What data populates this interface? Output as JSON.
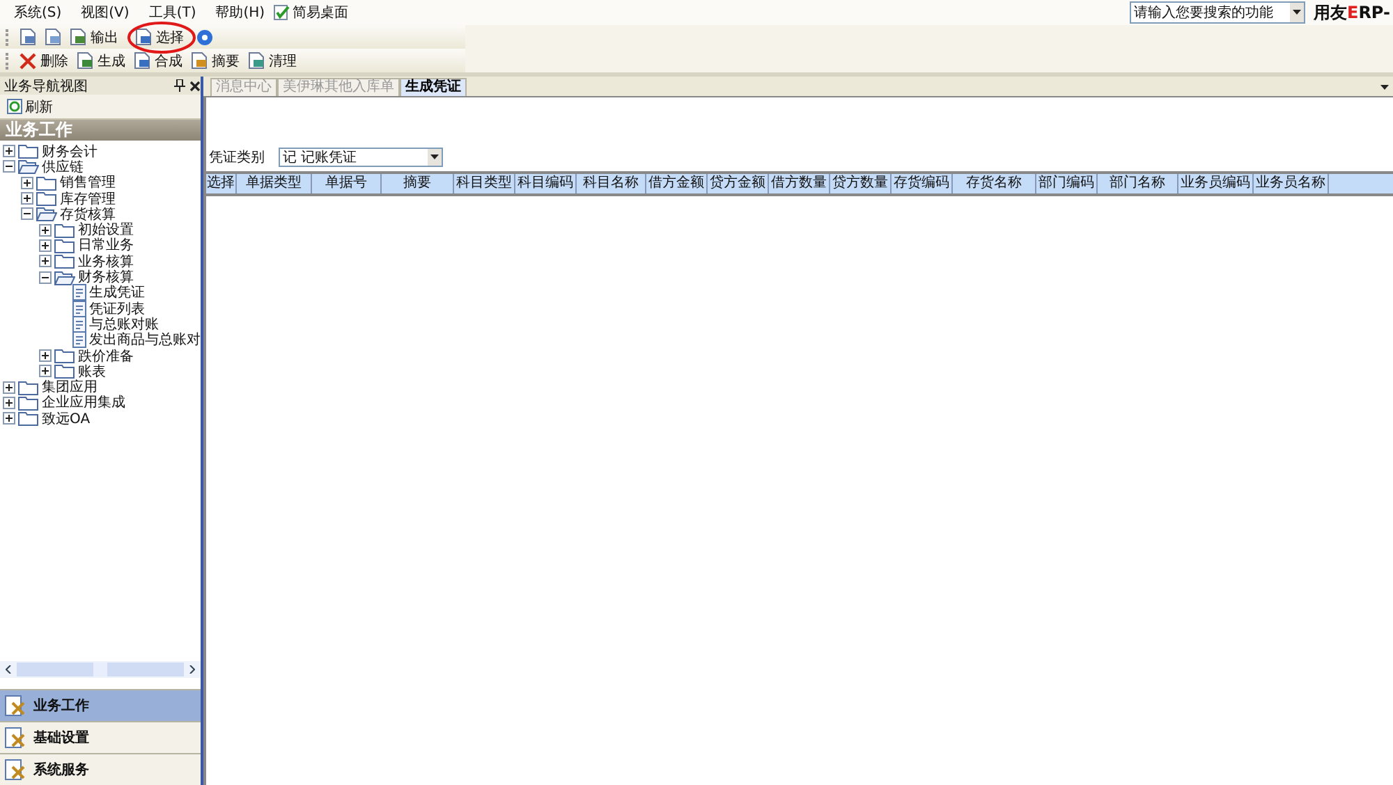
{
  "menu": [
    "系统(S)",
    "视图(V)",
    "工具(T)",
    "帮助(H)",
    "简易桌面"
  ],
  "search": {
    "placeholder": "请输入您要搜索的功能"
  },
  "logo": [
    {
      "text": "用友"
    },
    {
      "text": "E",
      "color": "#e02020"
    },
    {
      "text": "RP-"
    }
  ],
  "toolbar1": [
    {
      "kind": "print"
    },
    {
      "kind": "preview"
    },
    {
      "kind": "export",
      "label": "输出"
    },
    {
      "kind": "select",
      "label": "选择",
      "highlighted": true
    },
    {
      "kind": "help"
    }
  ],
  "toolbar2": [
    {
      "kind": "delete",
      "label": "删除"
    },
    {
      "kind": "generate",
      "label": "生成"
    },
    {
      "kind": "merge",
      "label": "合成"
    },
    {
      "kind": "summary",
      "label": "摘要"
    },
    {
      "kind": "clear",
      "label": "清理"
    }
  ],
  "nav": {
    "title": "业务导航视图",
    "refresh": "刷新",
    "section": "业务工作",
    "tree": [
      {
        "label": "财务会计",
        "expanded": false,
        "kind": "folder"
      },
      {
        "label": "供应链",
        "expanded": true,
        "kind": "folder",
        "children": [
          {
            "label": "销售管理",
            "expanded": false,
            "kind": "folder"
          },
          {
            "label": "库存管理",
            "expanded": false,
            "kind": "folder"
          },
          {
            "label": "存货核算",
            "expanded": true,
            "kind": "folder",
            "children": [
              {
                "label": "初始设置",
                "expanded": false,
                "kind": "folder"
              },
              {
                "label": "日常业务",
                "expanded": false,
                "kind": "folder"
              },
              {
                "label": "业务核算",
                "expanded": false,
                "kind": "folder"
              },
              {
                "label": "财务核算",
                "expanded": true,
                "kind": "folder",
                "children": [
                  {
                    "label": "生成凭证",
                    "kind": "doc"
                  },
                  {
                    "label": "凭证列表",
                    "kind": "doc"
                  },
                  {
                    "label": "与总账对账",
                    "kind": "doc"
                  },
                  {
                    "label": "发出商品与总账对",
                    "kind": "doc"
                  }
                ]
              },
              {
                "label": "跌价准备",
                "expanded": false,
                "kind": "folder"
              },
              {
                "label": "账表",
                "expanded": false,
                "kind": "folder"
              }
            ]
          }
        ]
      },
      {
        "label": "集团应用",
        "expanded": false,
        "kind": "folder"
      },
      {
        "label": "企业应用集成",
        "expanded": false,
        "kind": "folder"
      },
      {
        "label": "致远OA",
        "expanded": false,
        "kind": "folder"
      }
    ],
    "bottom": [
      {
        "label": "业务工作",
        "selected": true
      },
      {
        "label": "基础设置",
        "selected": false
      },
      {
        "label": "系统服务",
        "selected": false
      }
    ]
  },
  "tabs": [
    {
      "label": "消息中心",
      "selected": false
    },
    {
      "label": "美伊琳其他入库单",
      "selected": false
    },
    {
      "label": "生成凭证",
      "selected": true
    }
  ],
  "voucher_type": {
    "label": "凭证类别",
    "value": "记 记账凭证"
  },
  "table": {
    "columns": [
      "选择",
      "单据类型",
      "单据号",
      "摘要",
      "科目类型",
      "科目编码",
      "科目名称",
      "借方金额",
      "贷方金额",
      "借方数量",
      "贷方数量",
      "存货编码",
      "存货名称",
      "部门编码",
      "部门名称",
      "业务员编码",
      "业务员名称"
    ]
  }
}
